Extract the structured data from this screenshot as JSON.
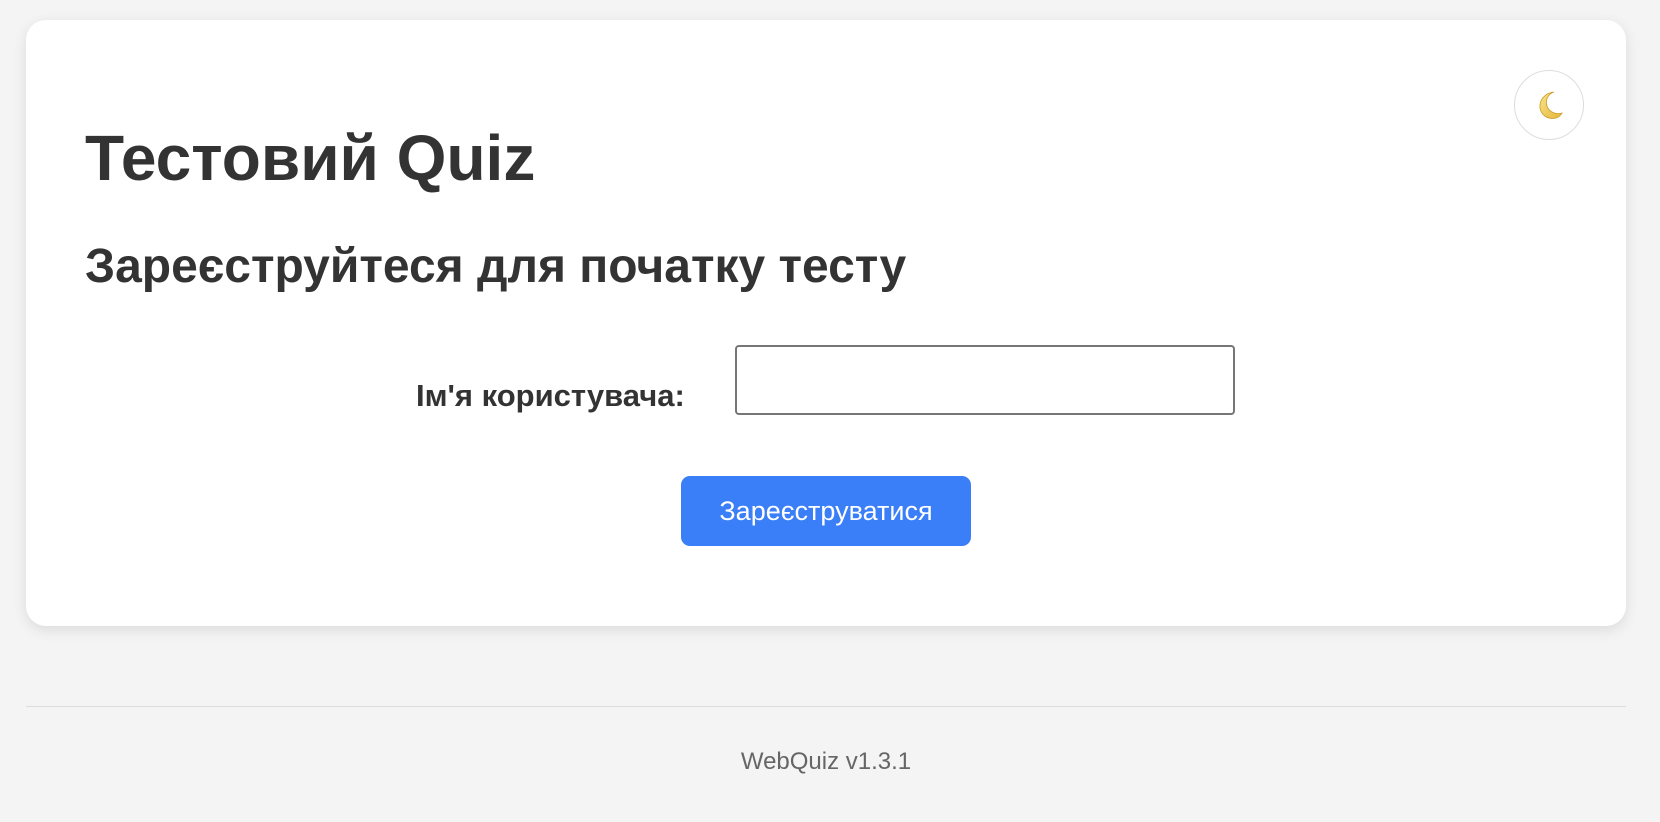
{
  "page": {
    "title": "Тестовий Quiz",
    "subtitle": "Зареєструйтеся для початку тесту"
  },
  "theme_toggle": {
    "icon": "moon-icon"
  },
  "form": {
    "username_label": "Ім'я користувача:",
    "username_value": "",
    "submit_label": "Зареєструватися"
  },
  "footer": {
    "version_text": "WebQuiz v1.3.1"
  },
  "colors": {
    "background": "#f4f4f4",
    "card": "#ffffff",
    "text": "#333333",
    "accent": "#3a7ef8",
    "muted": "#666666"
  }
}
